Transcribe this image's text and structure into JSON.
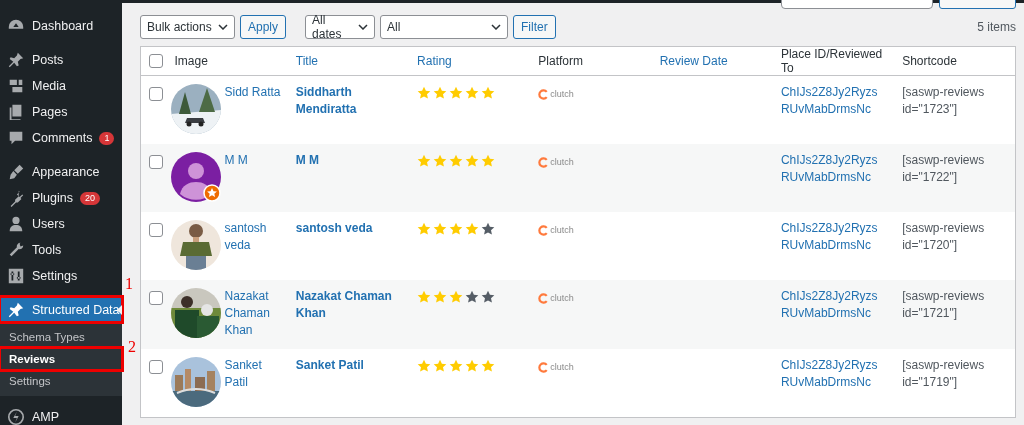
{
  "sidebar": {
    "groups": [
      [
        {
          "label": "Dashboard",
          "selected": false
        }
      ],
      [
        {
          "label": "Posts",
          "selected": false
        },
        {
          "label": "Media",
          "selected": false
        },
        {
          "label": "Pages",
          "selected": false
        },
        {
          "label": "Comments",
          "selected": false,
          "badge": "1"
        }
      ],
      [
        {
          "label": "Appearance",
          "selected": false
        },
        {
          "label": "Plugins",
          "selected": false,
          "badge": "20"
        },
        {
          "label": "Users",
          "selected": false
        },
        {
          "label": "Tools",
          "selected": false
        },
        {
          "label": "Settings",
          "selected": false
        }
      ],
      [
        {
          "label": "Structured Data",
          "selected": true,
          "annotation": "1",
          "children": [
            {
              "label": "Schema Types",
              "selected": false
            },
            {
              "label": "Reviews",
              "selected": true,
              "annotation": "2"
            },
            {
              "label": "Settings",
              "selected": false
            }
          ]
        }
      ],
      [
        {
          "label": "AMP",
          "selected": false
        }
      ]
    ]
  },
  "toolbar": {
    "bulk_actions": "Bulk actions",
    "apply": "Apply",
    "dates": "All dates",
    "platform_filter": "All",
    "filter": "Filter",
    "count": "5 items"
  },
  "table": {
    "select_all_checked": false,
    "columns": [
      {
        "label": "Image",
        "sortable": false
      },
      {
        "label": "Title",
        "sortable": true
      },
      {
        "label": "Rating",
        "sortable": true
      },
      {
        "label": "Platform",
        "sortable": false
      },
      {
        "label": "Review Date",
        "sortable": true
      },
      {
        "label": "Place ID/Reviewed To",
        "sortable": false
      },
      {
        "label": "Shortcode",
        "sortable": false
      }
    ],
    "rows": [
      {
        "checked": false,
        "name": "Sidd Ratta",
        "title": "Siddharth Mendiratta",
        "stars": 5,
        "platform": "clutch",
        "place_id": "ChIJs2Z8Jy2RyzsRUvMabDrmsNc",
        "shortcode": "[saswp-reviews id=\"1723\"]"
      },
      {
        "checked": false,
        "avatar": {
          "kind": "default"
        },
        "name": "M M",
        "title": "M M",
        "stars": 5,
        "platform": "clutch",
        "place_id": "ChIJs2Z8Jy2RyzsRUvMabDrmsNc",
        "shortcode": "[saswp-reviews id=\"1722\"]"
      },
      {
        "checked": false,
        "name": "santosh veda",
        "title": "santosh veda",
        "stars": 4,
        "platform": "clutch",
        "place_id": "ChIJs2Z8Jy2RyzsRUvMabDrmsNc",
        "shortcode": "[saswp-reviews id=\"1720\"]"
      },
      {
        "checked": false,
        "name": "Nazakat Chaman Khan",
        "title": "Nazakat Chaman Khan",
        "stars": 3,
        "platform": "clutch",
        "place_id": "ChIJs2Z8Jy2RyzsRUvMabDrmsNc",
        "shortcode": "[saswp-reviews id=\"1721\"]"
      },
      {
        "checked": false,
        "name": "Sanket Patil",
        "title": "Sanket Patil",
        "stars": 5,
        "platform": "clutch",
        "place_id": "ChIJs2Z8Jy2RyzsRUvMabDrmsNc",
        "shortcode": "[saswp-reviews id=\"1719\"]"
      }
    ]
  }
}
